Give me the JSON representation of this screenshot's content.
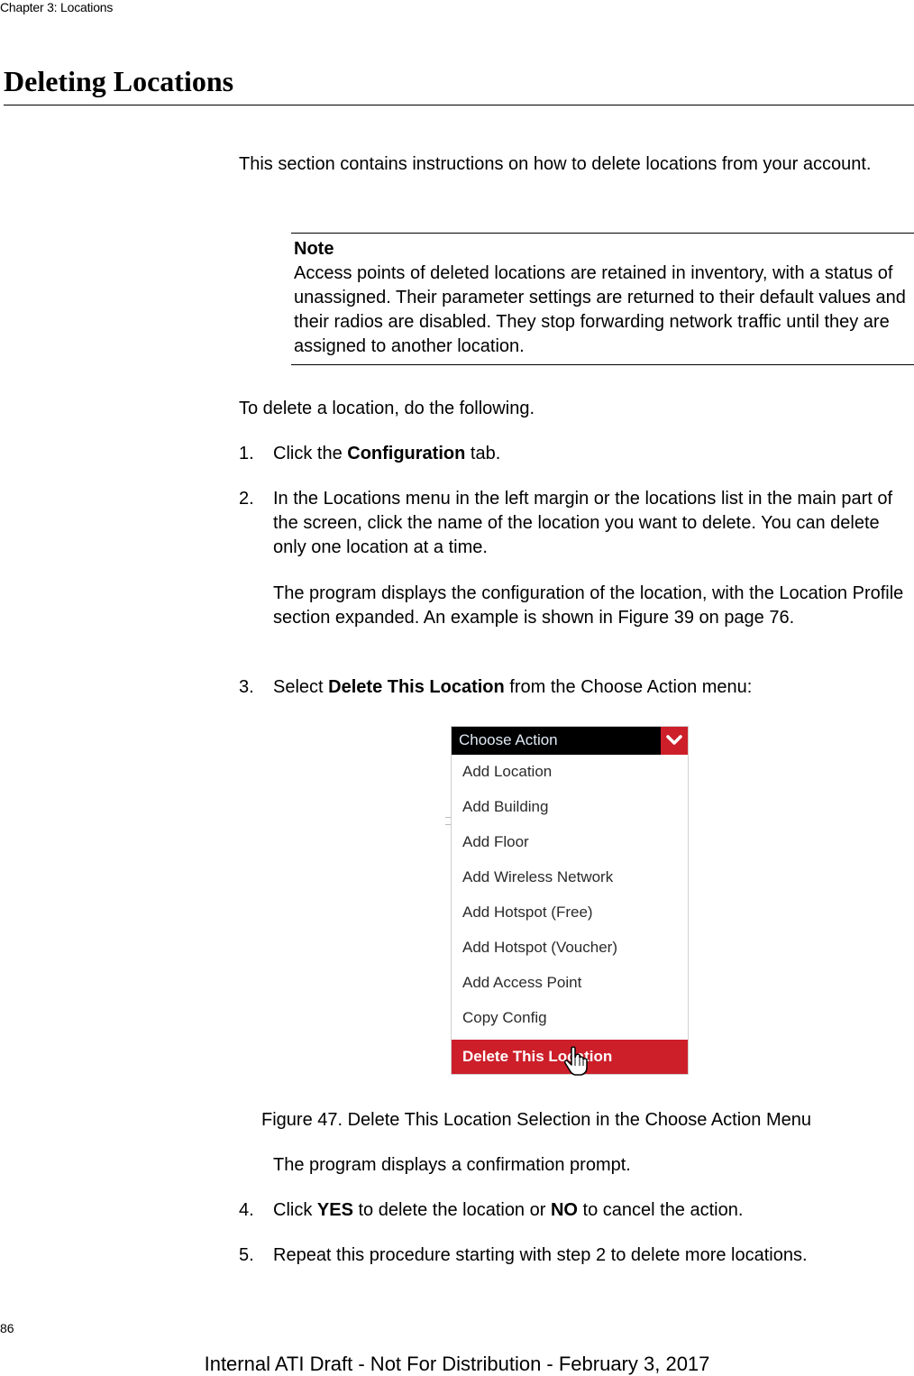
{
  "header": {
    "running_head": "Chapter 3: Locations"
  },
  "section": {
    "title": "Deleting Locations"
  },
  "intro": "This section contains instructions on how to delete locations from your account.",
  "note": {
    "title": "Note",
    "body": "Access points of deleted locations are retained in inventory, with a status of unassigned. Their parameter settings are returned to their default values and their radios are disabled. They stop forwarding network traffic until they are assigned to another location."
  },
  "lead": "To delete a location, do the following.",
  "steps": [
    {
      "num": "1.",
      "pre": "Click the ",
      "bold": "Configuration",
      "post": " tab."
    },
    {
      "num": "2.",
      "text": "In the Locations menu in the left margin or the locations list in the main part of the screen, click the name of the location you want to delete. You can delete only one location at a time.",
      "result": "The program displays the configuration of the location, with the Location Profile section expanded. An example is shown in Figure 39 on page 76."
    },
    {
      "num": "3.",
      "pre": "Select ",
      "bold": "Delete This Location",
      "post": " from the Choose Action menu:"
    },
    {
      "num": "4.",
      "pre": "Click ",
      "bold": "YES",
      "mid": " to delete the location or ",
      "bold2": "NO",
      "post": " to cancel the action."
    },
    {
      "num": "5.",
      "text": "Repeat this procedure starting with step 2 to delete more locations."
    }
  ],
  "figure": {
    "menu_label": "Choose Action",
    "chevron_icon": "chevron-down-icon",
    "items": [
      "Add Location",
      "Add Building",
      "Add Floor",
      "Add Wireless Network",
      "Add Hotspot (Free)",
      "Add Hotspot (Voucher)",
      "Add Access Point",
      "Copy Config",
      "Delete This Location"
    ],
    "selected_item": "Delete This Location",
    "accent_color": "#cc1f2a",
    "caption": "Figure 47. Delete This Location Selection in the Choose Action Menu",
    "after_text": "The program displays a confirmation prompt."
  },
  "footer": {
    "page_number": "86",
    "draft_notice": "Internal ATI Draft - Not For Distribution - February 3, 2017"
  }
}
